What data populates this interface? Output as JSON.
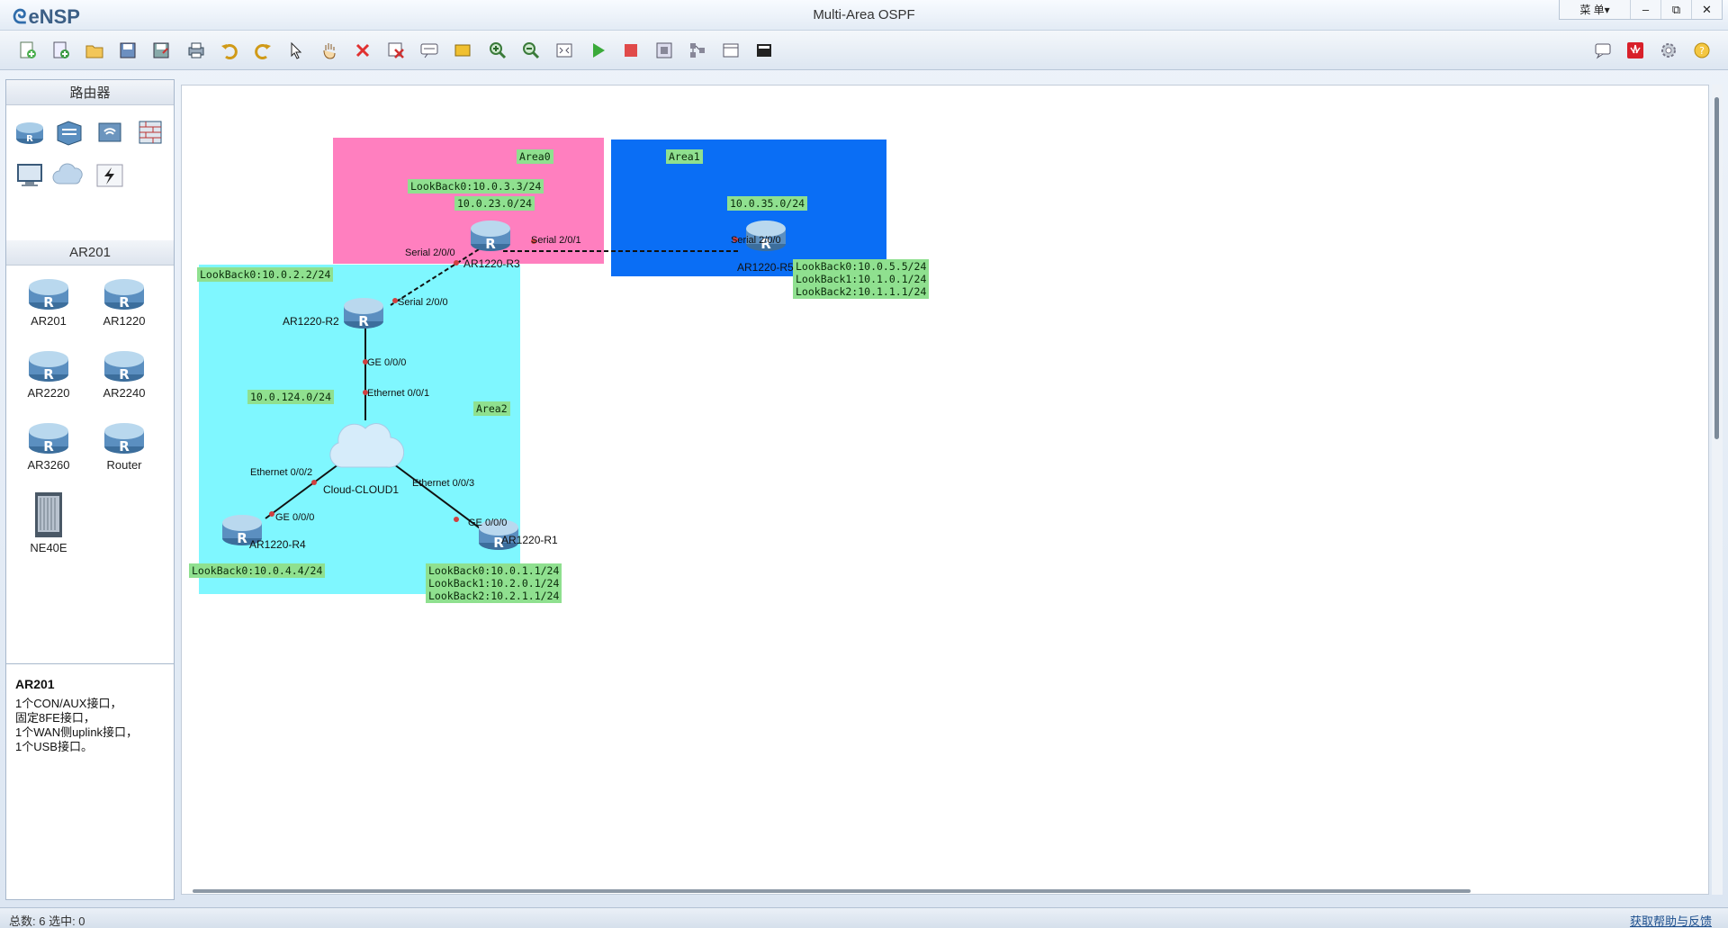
{
  "app": {
    "name": "eNSP",
    "window_title": "Multi-Area OSPF",
    "menu_label": "菜 单▾",
    "minimize": "–",
    "restore": "⧉",
    "close": "✕"
  },
  "toolbar": {
    "left": [
      "new-topology-icon",
      "new-lab-icon",
      "open-icon",
      "save-icon",
      "save-as-icon",
      "print-icon",
      "undo-icon",
      "redo-icon",
      "select-icon",
      "pan-hand-icon",
      "delete-icon",
      "delete-all-links-icon",
      "text-icon",
      "rectangle-icon",
      "zoom-in-icon",
      "zoom-out-icon",
      "fit-icon",
      "start-device-icon",
      "stop-device-icon",
      "capture-icon",
      "topology-icon",
      "grid-icon",
      "cli-icon"
    ],
    "right": [
      "chat-icon",
      "huawei-icon",
      "settings-icon",
      "help-icon"
    ]
  },
  "left_panel": {
    "category_title": "路由器",
    "categories": [
      "router-category-icon",
      "switch-category-icon",
      "wlan-category-icon",
      "firewall-category-icon",
      "pc-category-icon",
      "cloud-category-icon",
      "link-category-icon"
    ],
    "device_title": "AR201",
    "devices": [
      "AR201",
      "AR1220",
      "AR2220",
      "AR2240",
      "AR3260",
      "Router",
      "NE40E"
    ],
    "description": {
      "title": "AR201",
      "lines": [
        "1个CON/AUX接口，",
        "固定8FE接口，",
        "1个WAN侧uplink接口，",
        "1个USB接口。"
      ]
    }
  },
  "topology": {
    "areas": [
      {
        "name": "Area0",
        "color": "#ff7fbf"
      },
      {
        "name": "Area1",
        "color": "#0a6ef5"
      },
      {
        "name": "Area2",
        "color": "#7ff7ff"
      }
    ],
    "tags": {
      "r3_loop": "LookBack0:10.0.3.3/24",
      "net_23": "10.0.23.0/24",
      "net_35": "10.0.35.0/24",
      "r5_loops": [
        "LookBack0:10.0.5.5/24",
        "LookBack1:10.1.0.1/24",
        "LookBack2:10.1.1.1/24"
      ],
      "r2_loop": "LookBack0:10.0.2.2/24",
      "net_124": "10.0.124.0/24",
      "r4_loop": "LookBack0:10.0.4.4/24",
      "r1_loops": [
        "LookBack0:10.0.1.1/24",
        "LookBack1:10.2.0.1/24",
        "LookBack2:10.2.1.1/24"
      ]
    },
    "nodes": {
      "r3": "AR1220-R3",
      "r5": "AR1220-R5",
      "r2": "AR1220-R2",
      "r4": "AR1220-R4",
      "r1": "AR1220-R1",
      "cloud": "Cloud-CLOUD1"
    },
    "interfaces": {
      "r3_s200": "Serial 2/0/0",
      "r3_s201": "Serial 2/0/1",
      "r5_s200": "Serial 2/0/0",
      "r2_s200": "Serial 2/0/0",
      "r2_ge": "GE 0/0/0",
      "cloud_e1": "Ethernet 0/0/1",
      "cloud_e2": "Ethernet 0/0/2",
      "cloud_e3": "Ethernet 0/0/3",
      "r4_ge": "GE 0/0/0",
      "r1_ge": "GE 0/0/0"
    }
  },
  "status": {
    "left": "总数: 6  选中: 0",
    "right": "获取帮助与反馈"
  }
}
